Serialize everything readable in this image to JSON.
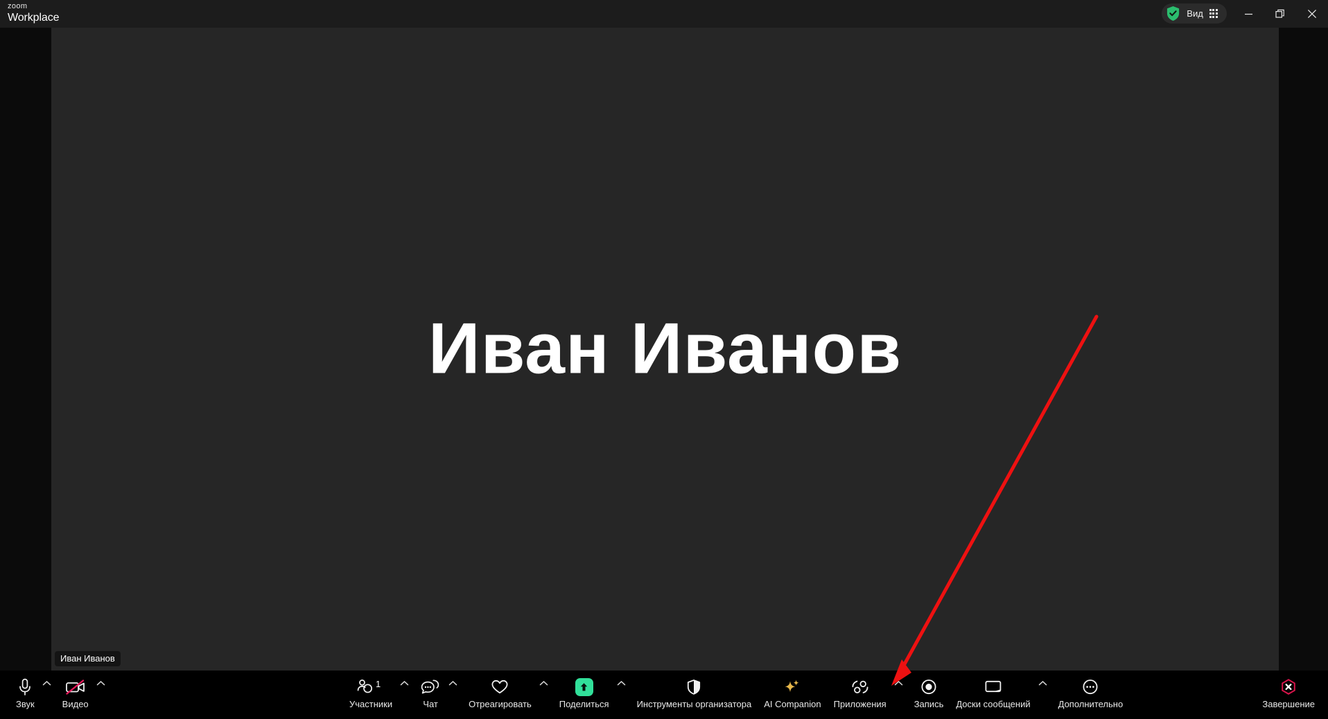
{
  "app": {
    "brand_top": "zoom",
    "brand_bottom": "Workplace",
    "background_color": "#0b0b0b",
    "titlebar_color": "#1c1c1c",
    "toolbar_color": "#000000"
  },
  "titlebar": {
    "view_button": {
      "label": "Вид",
      "shield_icon": "green-shield-check-icon",
      "grid_icon": "grid-view-icon",
      "shield_color": "#2bbd6e"
    },
    "window_controls": {
      "minimize": "minimize-icon",
      "maximize": "restore-icon",
      "close": "close-icon"
    }
  },
  "stage": {
    "participant_name_large": "Иван Иванов",
    "name_badge": "Иван Иванов",
    "tile_color": "#262626"
  },
  "annotation": {
    "arrow_color": "#ee1111",
    "points_to": "Запись"
  },
  "toolbar": {
    "left": [
      {
        "label": "Звук",
        "icon": "microphone-icon",
        "caret": true
      },
      {
        "label": "Видео",
        "icon": "video-camera-off-icon",
        "caret": true,
        "muted_color": "#e8195b"
      }
    ],
    "center": [
      {
        "label": "Участники",
        "icon": "participants-icon",
        "caret": true,
        "count": "1"
      },
      {
        "label": "Чат",
        "icon": "chat-bubble-icon",
        "caret": true
      },
      {
        "label": "Отреагировать",
        "icon": "heart-icon",
        "caret": true
      },
      {
        "label": "Поделиться",
        "icon": "share-screen-icon",
        "caret": true,
        "accent_color": "#31e09a"
      },
      {
        "label": "Инструменты организатора",
        "icon": "shield-host-tools-icon",
        "caret": false
      },
      {
        "label": "AI Companion",
        "icon": "sparkle-icon",
        "caret": false,
        "accent_color": "#e8b84b"
      },
      {
        "label": "Приложения",
        "icon": "apps-icon",
        "caret": true
      },
      {
        "label": "Запись",
        "icon": "record-circle-icon",
        "caret": false
      },
      {
        "label": "Доски сообщений",
        "icon": "whiteboard-icon",
        "caret": true
      },
      {
        "label": "Дополнительно",
        "icon": "more-ellipsis-icon",
        "caret": false
      }
    ],
    "right": [
      {
        "label": "Завершение",
        "icon": "end-call-hexagon-icon",
        "accent_color": "#d8144b"
      }
    ]
  }
}
